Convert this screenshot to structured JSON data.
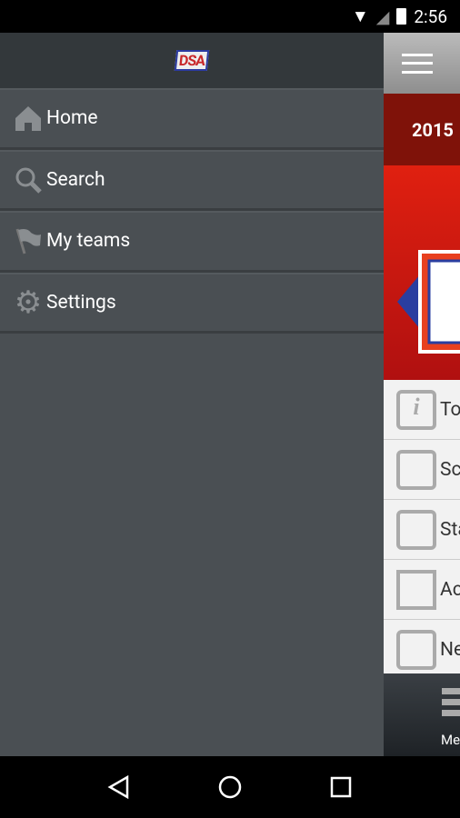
{
  "status": {
    "time": "2:56"
  },
  "drawer": {
    "logo": "DSA",
    "items": [
      {
        "label": "Home",
        "icon": "home-icon"
      },
      {
        "label": "Search",
        "icon": "search-icon"
      },
      {
        "label": "My teams",
        "icon": "flag-icon"
      },
      {
        "label": "Settings",
        "icon": "gear-icon"
      }
    ]
  },
  "main": {
    "year": "2015",
    "menu": [
      {
        "label": "To",
        "icon": "info-icon"
      },
      {
        "label": "Sc",
        "icon": "calendar-icon"
      },
      {
        "label": "Sta",
        "icon": "list-icon"
      },
      {
        "label": "Ac",
        "icon": "map-icon"
      },
      {
        "label": "Ne",
        "icon": "newspaper-icon"
      }
    ],
    "tab_label": "Me"
  }
}
